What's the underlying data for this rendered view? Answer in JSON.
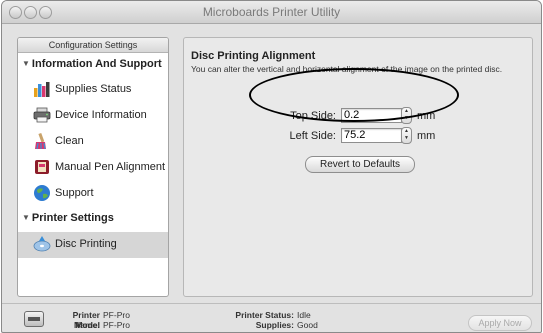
{
  "window": {
    "title": "Microboards Printer Utility"
  },
  "sidebar": {
    "header": "Configuration Settings",
    "groups": [
      {
        "label": "Information And Support",
        "items": [
          {
            "label": "Supplies Status",
            "icon": "supplies-icon"
          },
          {
            "label": "Device Information",
            "icon": "printer-icon"
          },
          {
            "label": "Clean",
            "icon": "clean-icon"
          },
          {
            "label": "Manual Pen Alignment",
            "icon": "pen-alignment-icon"
          },
          {
            "label": "Support",
            "icon": "globe-icon"
          }
        ]
      },
      {
        "label": "Printer Settings",
        "items": [
          {
            "label": "Disc Printing",
            "icon": "disc-icon",
            "selected": true
          }
        ]
      }
    ]
  },
  "main": {
    "title": "Disc Printing Alignment",
    "description": "You can alter the vertical and horizontal alignment of the image on the printed disc.",
    "top_side": {
      "label": "Top Side:",
      "value": "0.2",
      "unit": "mm"
    },
    "left_side": {
      "label": "Left Side:",
      "value": "75.2",
      "unit": "mm"
    },
    "revert_label": "Revert to Defaults"
  },
  "footer": {
    "printer_name_label": "Printer Name:",
    "printer_name": "PF-Pro",
    "model_name_label": "Model Name:",
    "model_name": "PF-Pro",
    "printer_status_label": "Printer Status:",
    "printer_status": "Idle",
    "supplies_label": "Supplies:",
    "supplies": "Good",
    "apply_label": "Apply Now"
  }
}
